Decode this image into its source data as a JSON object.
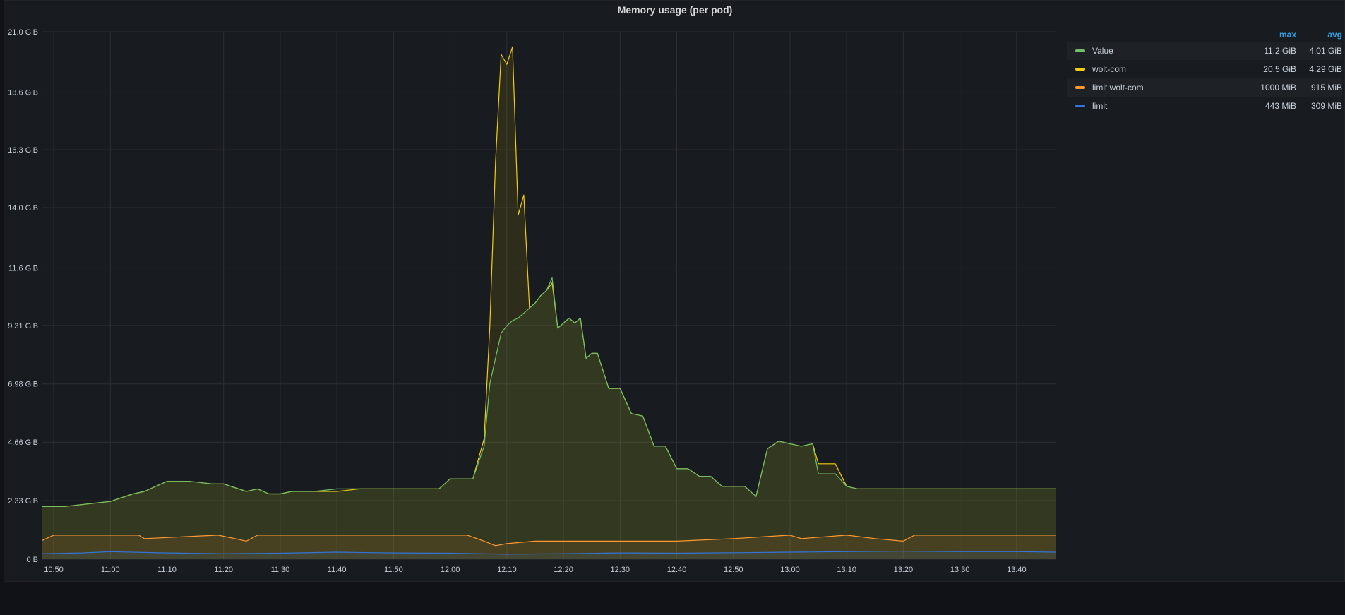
{
  "panel": {
    "title": "Memory usage (per pod)"
  },
  "legend": {
    "headers": {
      "max": "max",
      "avg": "avg"
    },
    "items": [
      {
        "name": "Value",
        "color": "#73bf69",
        "max": "11.2 GiB",
        "avg": "4.01 GiB"
      },
      {
        "name": "wolt-com",
        "color": "#f2cc0c",
        "max": "20.5 GiB",
        "avg": "4.29 GiB"
      },
      {
        "name": "limit wolt-com",
        "color": "#ff9830",
        "max": "1000 MiB",
        "avg": "915 MiB"
      },
      {
        "name": "limit",
        "color": "#3274d9",
        "max": "443 MiB",
        "avg": "309 MiB"
      }
    ]
  },
  "chart_data": {
    "type": "area",
    "title": "Memory usage (per pod)",
    "xlabel": "",
    "ylabel": "",
    "y_unit": "GiB",
    "ylim": [
      0,
      21.0
    ],
    "y_ticks": [
      0,
      2.33,
      4.66,
      6.98,
      9.31,
      11.6,
      14.0,
      16.3,
      18.6,
      21.0
    ],
    "y_tick_labels": [
      "0 B",
      "2.33 GiB",
      "4.66 GiB",
      "6.98 GiB",
      "9.31 GiB",
      "11.6 GiB",
      "14.0 GiB",
      "16.3 GiB",
      "18.6 GiB",
      "21.0 GiB"
    ],
    "x_unit": "minutes",
    "xlim": [
      648,
      827
    ],
    "x_ticks": [
      650,
      660,
      670,
      680,
      690,
      700,
      710,
      720,
      730,
      740,
      750,
      760,
      770,
      780,
      790,
      800,
      810,
      820
    ],
    "x_tick_labels": [
      "10:50",
      "11:00",
      "11:10",
      "11:20",
      "11:30",
      "11:40",
      "11:50",
      "12:00",
      "12:10",
      "12:20",
      "12:30",
      "12:40",
      "12:50",
      "13:00",
      "13:10",
      "13:20",
      "13:30",
      "13:40"
    ],
    "grid": true,
    "legend_position": "right",
    "series": [
      {
        "name": "wolt-com",
        "color": "#f2cc0c",
        "x": [
          648,
          652,
          656,
          660,
          664,
          666,
          670,
          674,
          678,
          680,
          684,
          686,
          688,
          690,
          692,
          696,
          700,
          704,
          708,
          712,
          716,
          718,
          720,
          722,
          724,
          726,
          727,
          728,
          729,
          730,
          731,
          732,
          733,
          734,
          735,
          736,
          737,
          738,
          739,
          740,
          741,
          742,
          743,
          744,
          745,
          746,
          748,
          750,
          752,
          754,
          756,
          758,
          760,
          762,
          764,
          766,
          768,
          770,
          772,
          774,
          776,
          778,
          780,
          782,
          784,
          785,
          786,
          788,
          790,
          792,
          794,
          796,
          798,
          800,
          802,
          804,
          806,
          808,
          810,
          812,
          814,
          816,
          818,
          820,
          822,
          824,
          827
        ],
        "y": [
          2.1,
          2.1,
          2.2,
          2.3,
          2.6,
          2.7,
          3.1,
          3.1,
          3.0,
          3.0,
          2.7,
          2.8,
          2.6,
          2.6,
          2.7,
          2.7,
          2.7,
          2.8,
          2.8,
          2.8,
          2.8,
          2.8,
          3.2,
          3.2,
          3.2,
          4.8,
          9.3,
          15.8,
          20.1,
          19.7,
          20.4,
          13.7,
          14.5,
          10.0,
          10.2,
          10.5,
          10.7,
          11.0,
          9.2,
          9.4,
          9.6,
          9.4,
          9.6,
          8.0,
          8.2,
          8.2,
          6.8,
          6.8,
          5.8,
          5.7,
          4.5,
          4.5,
          3.6,
          3.6,
          3.3,
          3.3,
          2.9,
          2.9,
          2.9,
          2.5,
          4.4,
          4.7,
          4.6,
          4.5,
          4.6,
          3.8,
          3.8,
          3.8,
          2.9,
          2.8,
          2.8,
          2.8,
          2.8,
          2.8,
          2.8,
          2.8,
          2.8,
          2.8,
          2.8,
          2.8,
          2.8,
          2.8,
          2.8,
          2.8,
          2.8,
          2.8,
          2.8
        ]
      },
      {
        "name": "Value",
        "color": "#73bf69",
        "x": [
          648,
          652,
          656,
          660,
          664,
          666,
          670,
          674,
          678,
          680,
          684,
          686,
          688,
          690,
          692,
          696,
          700,
          704,
          708,
          712,
          716,
          718,
          720,
          722,
          724,
          726,
          727,
          728,
          729,
          730,
          731,
          732,
          733,
          734,
          735,
          736,
          737,
          738,
          739,
          740,
          741,
          742,
          743,
          744,
          745,
          746,
          748,
          750,
          752,
          754,
          756,
          758,
          760,
          762,
          764,
          766,
          768,
          770,
          772,
          774,
          776,
          778,
          780,
          782,
          784,
          785,
          786,
          788,
          790,
          792,
          794,
          796,
          798,
          800,
          802,
          804,
          806,
          808,
          810,
          812,
          814,
          816,
          818,
          820,
          822,
          824,
          827
        ],
        "y": [
          2.1,
          2.1,
          2.2,
          2.3,
          2.6,
          2.7,
          3.1,
          3.1,
          3.0,
          3.0,
          2.7,
          2.8,
          2.6,
          2.6,
          2.7,
          2.7,
          2.8,
          2.8,
          2.8,
          2.8,
          2.8,
          2.8,
          3.2,
          3.2,
          3.2,
          4.5,
          7.0,
          8.0,
          9.0,
          9.3,
          9.5,
          9.6,
          9.8,
          10.0,
          10.2,
          10.5,
          10.7,
          11.2,
          9.2,
          9.4,
          9.6,
          9.4,
          9.6,
          8.0,
          8.2,
          8.2,
          6.8,
          6.8,
          5.8,
          5.7,
          4.5,
          4.5,
          3.6,
          3.6,
          3.3,
          3.3,
          2.9,
          2.9,
          2.9,
          2.5,
          4.4,
          4.7,
          4.6,
          4.5,
          4.6,
          3.4,
          3.4,
          3.4,
          2.9,
          2.8,
          2.8,
          2.8,
          2.8,
          2.8,
          2.8,
          2.8,
          2.8,
          2.8,
          2.8,
          2.8,
          2.8,
          2.8,
          2.8,
          2.8,
          2.8,
          2.8,
          2.8
        ]
      },
      {
        "name": "limit wolt-com",
        "color": "#ff9830",
        "x": [
          648,
          650,
          665,
          666,
          679,
          682,
          684,
          686,
          723,
          726,
          728,
          730,
          735,
          740,
          745,
          750,
          760,
          770,
          780,
          782,
          790,
          795,
          800,
          802,
          810,
          827
        ],
        "y": [
          0.75,
          0.96,
          0.96,
          0.82,
          0.96,
          0.82,
          0.72,
          0.96,
          0.96,
          0.72,
          0.54,
          0.62,
          0.72,
          0.72,
          0.72,
          0.72,
          0.72,
          0.82,
          0.96,
          0.82,
          0.96,
          0.82,
          0.72,
          0.96,
          0.96,
          0.96
        ]
      },
      {
        "name": "limit",
        "color": "#3274d9",
        "x": [
          648,
          655,
          660,
          670,
          680,
          690,
          700,
          710,
          720,
          730,
          740,
          750,
          760,
          770,
          780,
          790,
          800,
          810,
          820,
          827
        ],
        "y": [
          0.22,
          0.25,
          0.3,
          0.25,
          0.22,
          0.24,
          0.28,
          0.25,
          0.24,
          0.2,
          0.22,
          0.25,
          0.24,
          0.26,
          0.28,
          0.3,
          0.32,
          0.3,
          0.3,
          0.28
        ]
      }
    ]
  }
}
